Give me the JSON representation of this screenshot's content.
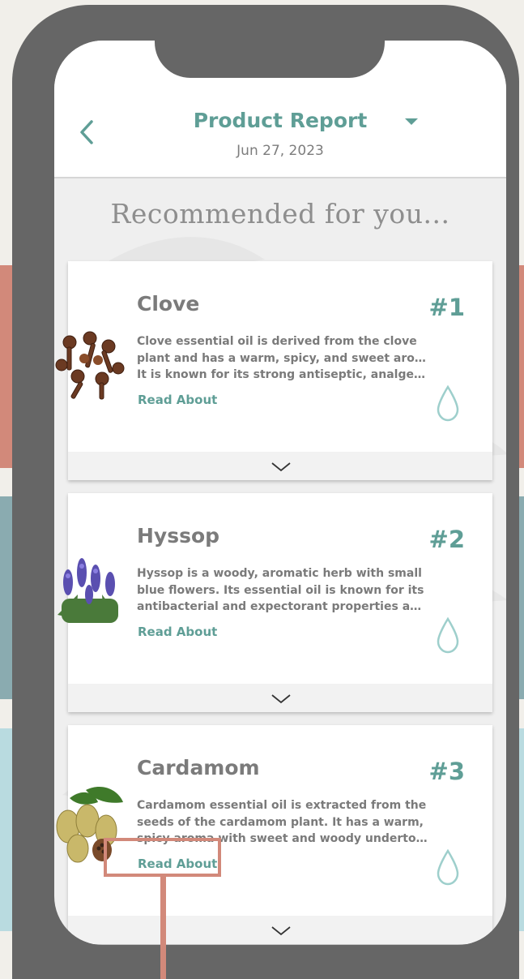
{
  "header": {
    "title": "Product Report",
    "date": "Jun 27, 2023"
  },
  "heading": "Recommended for you...",
  "colors": {
    "accent": "#5f9e96",
    "highlight": "#d2897a"
  },
  "cards": [
    {
      "name": "Clove",
      "rank": "#1",
      "description": [
        "Clove essential oil is derived from the clove",
        "plant and has a warm, spicy, and sweet aroma.",
        "It is known for its strong antiseptic, analgesic..."
      ],
      "link": "Read About",
      "image": "clove-image",
      "icon": "droplet-icon"
    },
    {
      "name": "Hyssop",
      "rank": "#2",
      "description": [
        "Hyssop is a woody, aromatic herb with small",
        "blue flowers. Its essential oil is known for its",
        "antibacterial and expectorant properties and ..."
      ],
      "link": "Read About",
      "image": "hyssop-image",
      "icon": "droplet-icon"
    },
    {
      "name": "Cardamom",
      "rank": "#3",
      "description": [
        "Cardamom essential oil is extracted from the",
        "seeds of the cardamom plant. It has a warm,",
        "spicy aroma with sweet and woody undertone..."
      ],
      "link": "Read About",
      "image": "cardamom-image",
      "icon": "droplet-icon"
    }
  ]
}
